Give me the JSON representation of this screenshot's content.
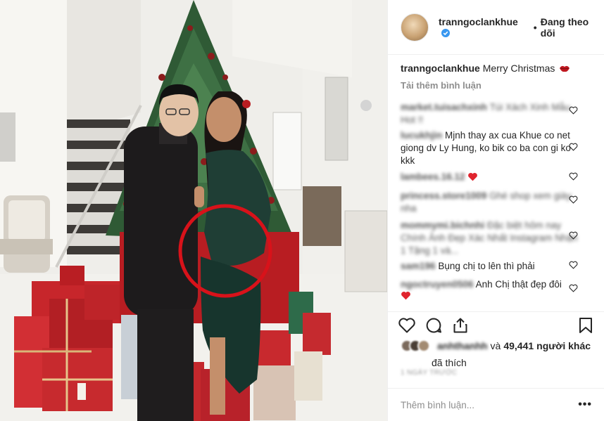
{
  "post": {
    "username": "tranngoclankhue",
    "follow_status": "Đang theo dõi",
    "dot": "•",
    "caption": "Merry Christmas",
    "load_more": "Tải thêm bình luận",
    "likes_count": "49,441",
    "likes_prefix": "và",
    "likes_suffix": "người khác",
    "likes_line2": "đã thích",
    "blurred_liker": "anhthanhh",
    "time": "1 NGÀY TRƯỚC",
    "add_comment_placeholder": "Thêm bình luận...",
    "more_label": "•••"
  },
  "comments": [
    {
      "user": "market.tuisachxinh",
      "text": "Túi Xách Xinh Mẫu Hot !!"
    },
    {
      "user": "lucukhjin",
      "text": "Mjnh thay ax cua Khue co net giong dv Ly Hung, ko bik co ba con gi ko kkk"
    },
    {
      "user": "lambees.16.12",
      "text": ""
    },
    {
      "user": "princess.store1009",
      "text": "Ghé shop xem giày nha"
    },
    {
      "user": "mommymi.bichnhi",
      "text": "Đặc biệt hôm nay Chính Ảnh Đẹp Xác Nhất Instagram Nhận 1 Tặng 1 và..."
    },
    {
      "user": "sam196",
      "text": "Bụng chị to lên thì phải"
    },
    {
      "user": "ngoctruyen0506",
      "text": "Anh Chị thật đẹp đôi"
    }
  ],
  "icons": [
    "verified-icon",
    "lips-emoji-icon",
    "heart-icon",
    "comment-icon",
    "share-icon",
    "bookmark-icon",
    "heart-emoji-icon"
  ],
  "colors": {
    "verified": "#3897f0",
    "accent_red": "#e0242e",
    "circle_red": "#d8121a",
    "muted": "#8e8e8e"
  }
}
